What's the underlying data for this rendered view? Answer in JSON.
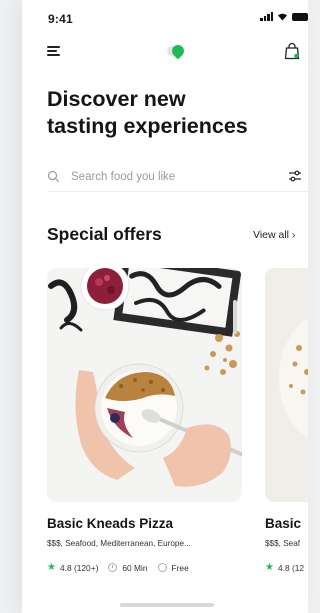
{
  "status_bar": {
    "time": "9:41"
  },
  "header": {
    "title_line1": "Discover new",
    "title_line2": "tasting experiences"
  },
  "search": {
    "placeholder": "Search food you like"
  },
  "special_offers": {
    "title": "Special offers",
    "view_all_label": "View all",
    "view_all_chevron": "›"
  },
  "cards": [
    {
      "name": "Basic Kneads Pizza",
      "description": "$$$, Seafood, Mediterranean, Europe...",
      "rating": "4.8 (120+)",
      "time": "60 Min",
      "delivery": "Free"
    },
    {
      "name": "Basic",
      "description": "$$$, Seaf",
      "rating": "4.8 (12"
    }
  ],
  "colors": {
    "accent": "#1db954",
    "background": "#ffffff",
    "text": "#151515"
  },
  "icons": [
    "menu-icon",
    "logo-icon",
    "shopping-bag-icon",
    "search-icon",
    "filter-icon",
    "star-icon",
    "clock-icon",
    "info-icon"
  ]
}
